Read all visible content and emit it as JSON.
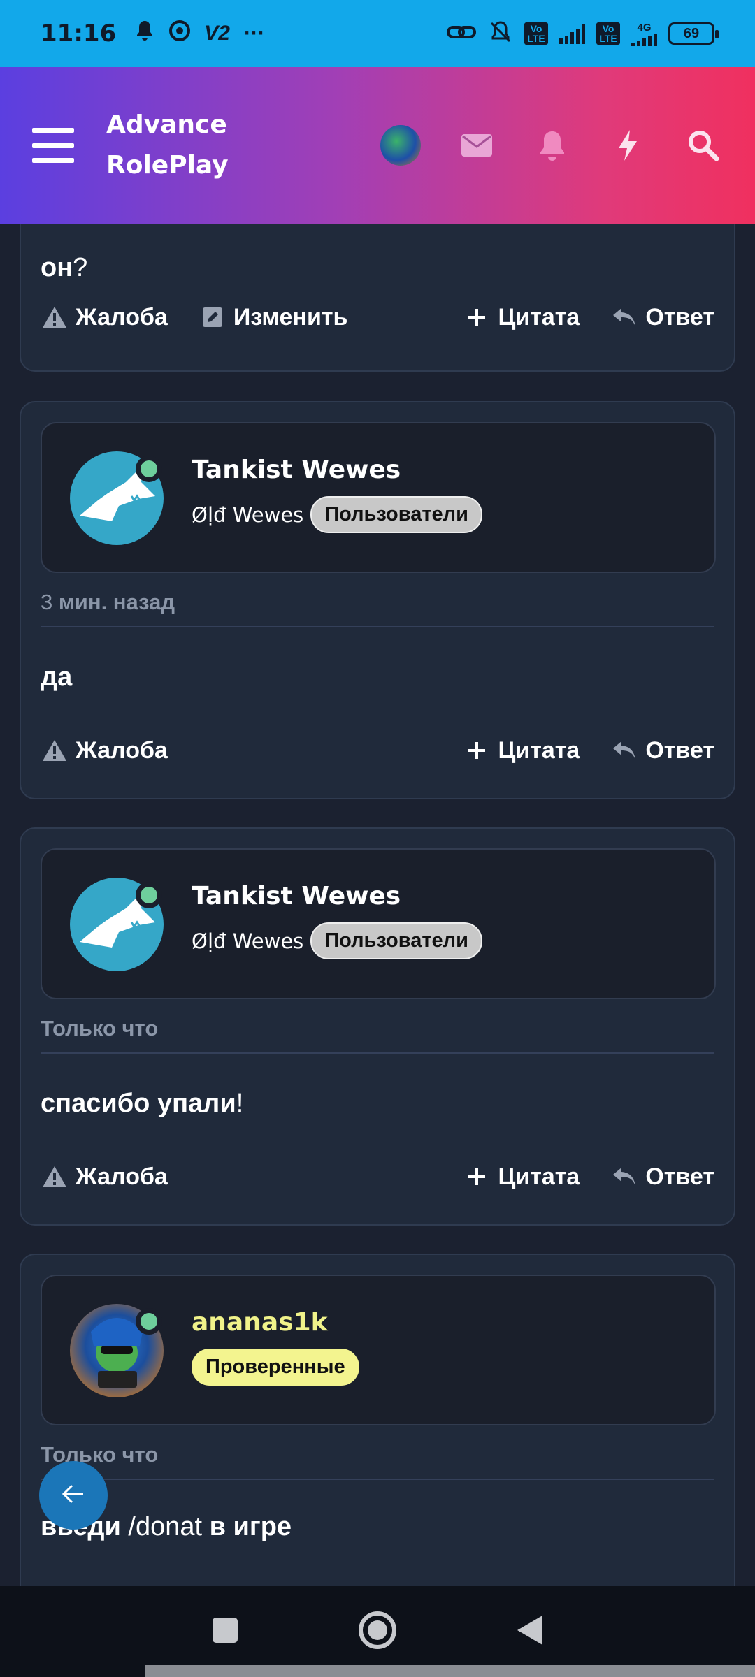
{
  "status_bar": {
    "time": "11:16",
    "carrier_tag": "V2",
    "more": "···",
    "volte1": "Vo LTE",
    "volte2": "Vo LTE",
    "net": "4G",
    "battery": "69"
  },
  "header": {
    "brand_line1": "Advance",
    "brand_line2": "RolePlay",
    "icons": [
      "menu-icon",
      "avatar",
      "mail-icon",
      "bell-icon",
      "bolt-icon",
      "search-icon"
    ]
  },
  "partial_post": {
    "text_bold": "он",
    "text_thin": "?",
    "actions": {
      "report": "Жалоба",
      "edit": "Изменить",
      "quote": "Цитата",
      "reply": "Ответ"
    }
  },
  "posts": [
    {
      "username": "Tankist Wewes",
      "subtitle": "Øḷđ Wewes",
      "group": "Пользователи",
      "time_num": "3",
      "time_rest": " мин. назад",
      "text_bold": "да",
      "text_thin": "",
      "actions": {
        "report": "Жалоба",
        "quote": "Цитата",
        "reply": "Ответ"
      }
    },
    {
      "username": "Tankist Wewes",
      "subtitle": "Øḷđ Wewes",
      "group": "Пользователи",
      "time_num": "",
      "time_rest": "Только что",
      "text_bold": "спасибо упали",
      "text_thin": "!",
      "actions": {
        "report": "Жалоба",
        "quote": "Цитата",
        "reply": "Ответ"
      }
    },
    {
      "username": "ananas1k",
      "group": "Проверенные",
      "time_rest": "Только что",
      "text_part1": "введи",
      "text_part2": " /donat ",
      "text_part3": "в игре"
    }
  ],
  "colors": {
    "accent_gradient_start": "#5b3fe0",
    "accent_gradient_end": "#f0305f",
    "online": "#6ecf9c",
    "verified_badge": "#f3f48f"
  }
}
